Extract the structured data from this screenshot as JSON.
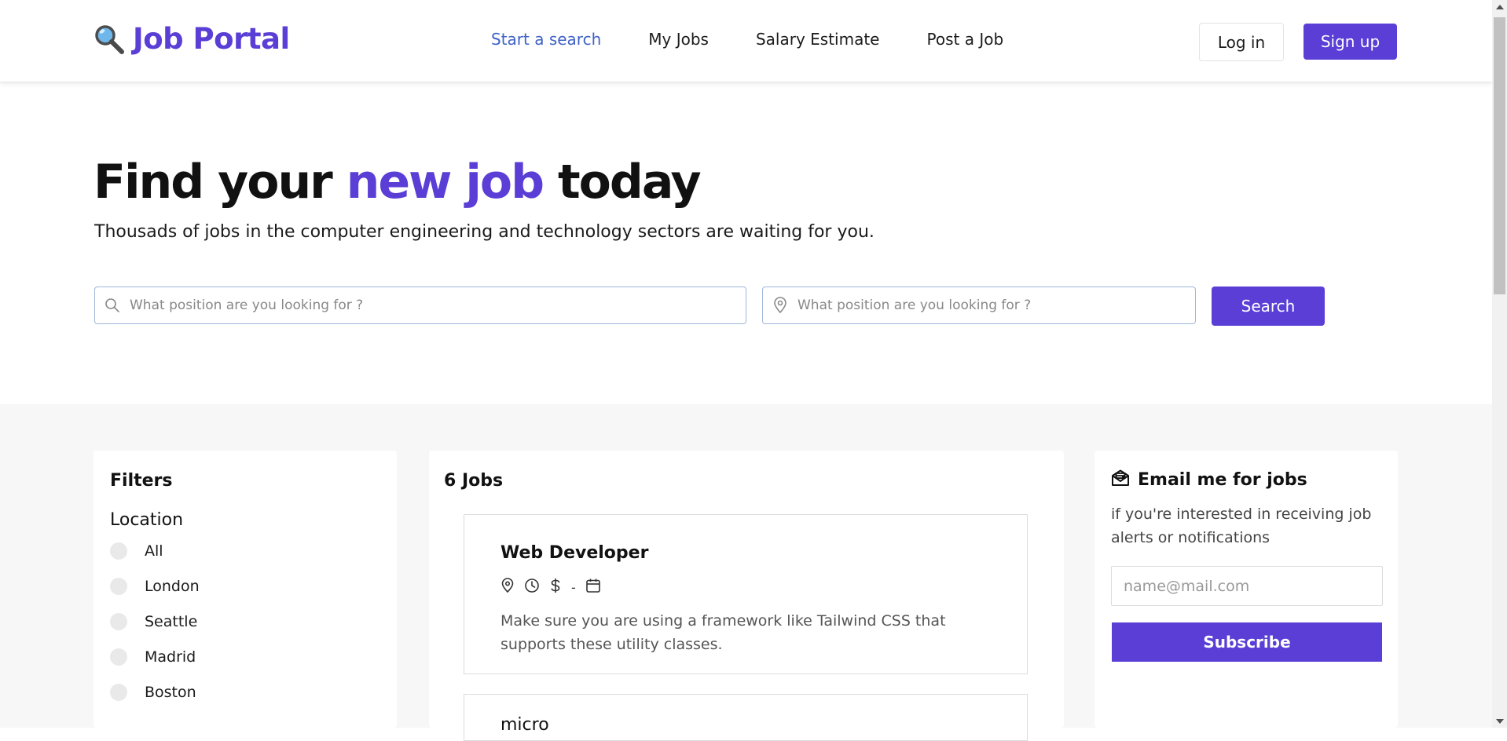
{
  "brand": {
    "name": "Job Portal",
    "icon": "magnifier-icon",
    "color": "#5a3ed6"
  },
  "nav": {
    "items": [
      {
        "label": "Start a search",
        "active": true
      },
      {
        "label": "My Jobs",
        "active": false
      },
      {
        "label": "Salary Estimate",
        "active": false
      },
      {
        "label": "Post a Job",
        "active": false
      }
    ],
    "active_color": "#3f62c7"
  },
  "auth": {
    "login_label": "Log in",
    "signup_label": "Sign up"
  },
  "hero": {
    "title_part1": "Find your",
    "title_accent": "new job",
    "title_part2": "today",
    "subtitle": "Thousads of jobs in the computer engineering and technology sectors are waiting for you."
  },
  "search": {
    "position_placeholder": "What position are you looking for ?",
    "location_placeholder": "What position are you looking for ?",
    "button_label": "Search"
  },
  "filters": {
    "title": "Filters",
    "location_title": "Location",
    "locations": [
      "All",
      "London",
      "Seattle",
      "Madrid",
      "Boston"
    ]
  },
  "jobs": {
    "count_label": "6 Jobs",
    "items": [
      {
        "title": "Web Developer",
        "meta_separator": "-",
        "description": "Make sure you are using a framework like Tailwind CSS that supports these utility classes."
      },
      {
        "title": "micro"
      }
    ]
  },
  "email_alert": {
    "title": "Email me for jobs",
    "icon": "mail-icon",
    "description": "if you're interested in receiving job alerts or notifications",
    "input_placeholder": "name@mail.com",
    "button_label": "Subscribe"
  },
  "colors": {
    "accent": "#5a3ed6",
    "lower_bg": "#f7f7f7"
  }
}
